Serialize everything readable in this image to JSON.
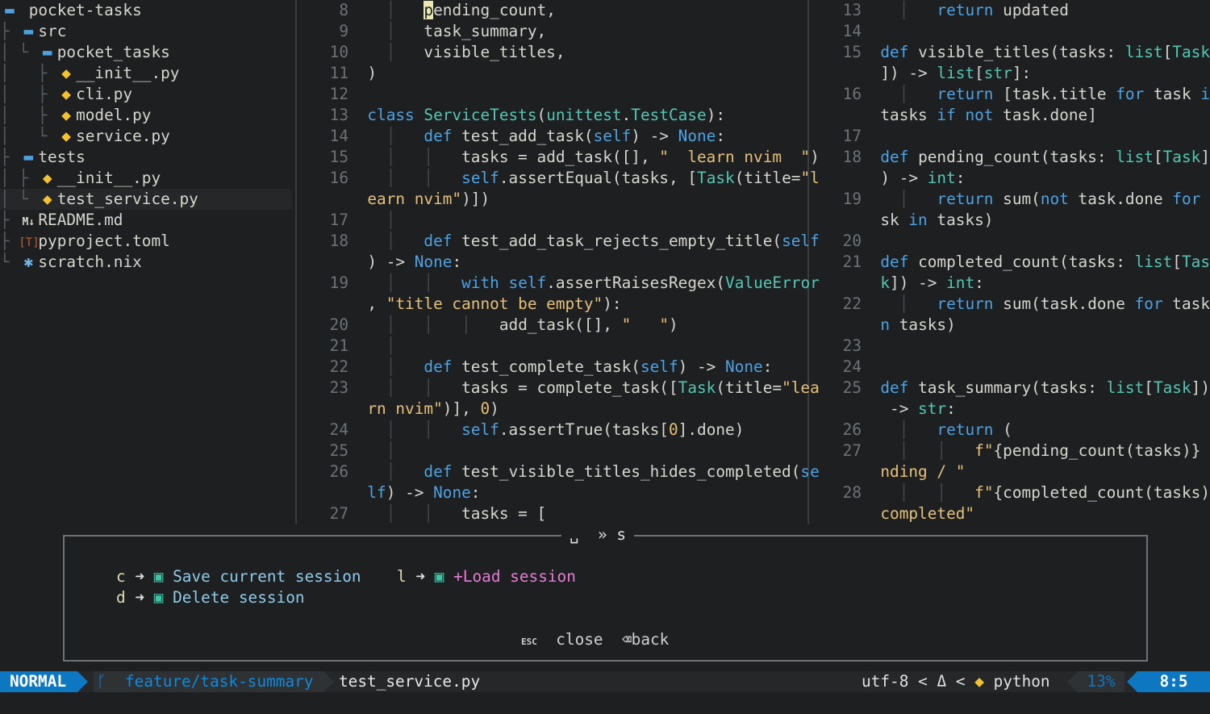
{
  "tree": {
    "root": "pocket-tasks",
    "items": [
      {
        "name": "src"
      },
      {
        "name": "pocket_tasks"
      },
      {
        "name": "__init__.py"
      },
      {
        "name": "cli.py"
      },
      {
        "name": "model.py"
      },
      {
        "name": "service.py"
      },
      {
        "name": "tests"
      },
      {
        "name": "__init__.py"
      },
      {
        "name": "test_service.py"
      },
      {
        "name": "README.md"
      },
      {
        "name": "pyproject.toml"
      },
      {
        "name": "scratch.nix"
      }
    ]
  },
  "icons": {
    "folder": "folder-icon",
    "python": "python-icon",
    "markdown": "markdown-icon",
    "toml": "toml-icon",
    "nix": "nix-icon"
  },
  "left_editor": {
    "file": "test_service.py",
    "numbers": [
      "8",
      "9",
      "10",
      "11",
      "12",
      "13",
      "14",
      "15",
      "16",
      "",
      "17",
      "18",
      "",
      "19",
      "",
      "20",
      "21",
      "22",
      "23",
      "",
      "24",
      "25",
      "26",
      "",
      "27"
    ]
  },
  "right_editor": {
    "file": "service.py",
    "numbers": [
      "13",
      "14",
      "15",
      "",
      "16",
      "",
      "17",
      "18",
      "",
      "19",
      "",
      "20",
      "21",
      "",
      "22",
      "",
      "23",
      "24",
      "25",
      "",
      "26",
      "27",
      "",
      "28",
      ""
    ]
  },
  "which_key": {
    "title": "␣  » s",
    "entries": [
      {
        "key": "c",
        "label": "Save current session"
      },
      {
        "key": "l",
        "label": "+Load session"
      },
      {
        "key": "d",
        "label": "Delete session"
      }
    ],
    "footer_esc_key": "ESC",
    "footer_close": "close",
    "footer_back": "back"
  },
  "statusline": {
    "mode": "NORMAL",
    "branch": "feature/task-summary",
    "filename": "test_service.py",
    "encoding": "utf-8",
    "filetype": "python",
    "progress": "13%",
    "position": "8:5"
  },
  "colors": {
    "accent": "#0d77c2",
    "keyword": "#4da3e4",
    "class": "#53c7b4",
    "string": "#e6c07a"
  }
}
